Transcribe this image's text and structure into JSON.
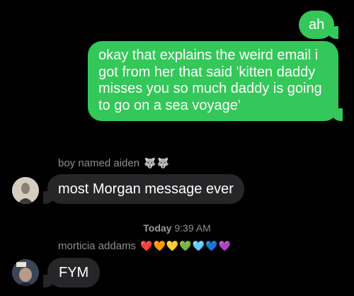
{
  "messages": {
    "m1": "ah",
    "m2": "okay that explains the weird email i got from her that said 'kitten daddy misses you so much daddy is going to go on a sea voyage'",
    "m3": "most Morgan message ever",
    "m4": "FYM"
  },
  "senders": {
    "aiden": {
      "name": "boy named aiden",
      "emoji": "🐺🐺"
    },
    "morticia": {
      "name": "morticia addams",
      "emoji": "❤️🧡💛💚🩵💙💜"
    }
  },
  "timestamp": {
    "day": "Today",
    "time": "9:39 AM"
  },
  "colors": {
    "sent": "#34c759",
    "received": "#262628",
    "meta": "#8e8e93"
  }
}
